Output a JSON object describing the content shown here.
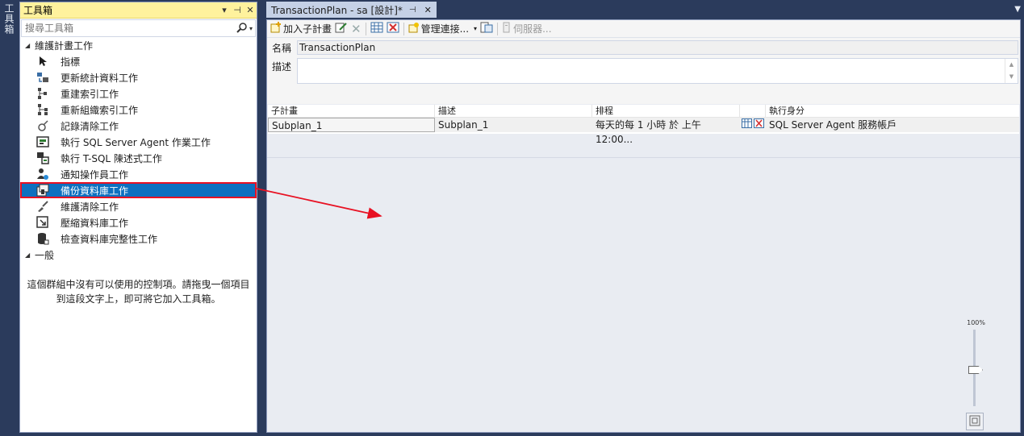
{
  "side_tab": {
    "label": "工具箱"
  },
  "toolbox": {
    "title": "工具箱",
    "pin_label": "▾ ⊣",
    "close_label": "✕",
    "search_placeholder": "搜尋工具箱",
    "groups": [
      {
        "label": "維護計畫工作",
        "items": [
          {
            "label": "指標",
            "icon": "pointer-icon",
            "selected": false
          },
          {
            "label": "更新統計資料工作",
            "icon": "update-statistics-icon",
            "selected": false
          },
          {
            "label": "重建索引工作",
            "icon": "rebuild-index-icon",
            "selected": false
          },
          {
            "label": "重新組織索引工作",
            "icon": "reorganize-index-icon",
            "selected": false
          },
          {
            "label": "記錄清除工作",
            "icon": "history-cleanup-icon",
            "selected": false
          },
          {
            "label": "執行 SQL Server Agent 作業工作",
            "icon": "agent-job-icon",
            "selected": false
          },
          {
            "label": "執行 T-SQL 陳述式工作",
            "icon": "tsql-icon",
            "selected": false
          },
          {
            "label": "通知操作員工作",
            "icon": "notify-operator-icon",
            "selected": false
          },
          {
            "label": "備份資料庫工作",
            "icon": "backup-database-icon",
            "selected": true
          },
          {
            "label": "維護清除工作",
            "icon": "maintenance-cleanup-icon",
            "selected": false
          },
          {
            "label": "壓縮資料庫工作",
            "icon": "shrink-database-icon",
            "selected": false
          },
          {
            "label": "檢查資料庫完整性工作",
            "icon": "check-integrity-icon",
            "selected": false
          }
        ]
      },
      {
        "label": "一般",
        "items": []
      }
    ],
    "general_message": "這個群組中沒有可以使用的控制項。請拖曳一個項目到這段文字上，即可將它加入工具箱。"
  },
  "document": {
    "tab_title": "TransactionPlan - sa [設計]*",
    "toolbar": {
      "add_subplan": "加入子計畫",
      "manage_connections": "管理連接...",
      "servers": "伺服器..."
    },
    "name_label": "名稱",
    "name_value": "TransactionPlan",
    "description_label": "描述",
    "description_value": "",
    "grid": {
      "columns": [
        "子計畫",
        "描述",
        "排程",
        "",
        "執行身分"
      ],
      "rows": [
        {
          "subplan": "Subplan_1",
          "description": "Subplan_1",
          "schedule": "每天的每 1 小時 於 上午 12:00...",
          "run_as": "SQL Server Agent 服務帳戶"
        }
      ]
    },
    "zoom_label": "100%"
  },
  "colors": {
    "title_highlight": "#fff29d",
    "selection": "#0e70c0",
    "annotation_red": "#e81123",
    "chrome": "#2b3b5c"
  }
}
